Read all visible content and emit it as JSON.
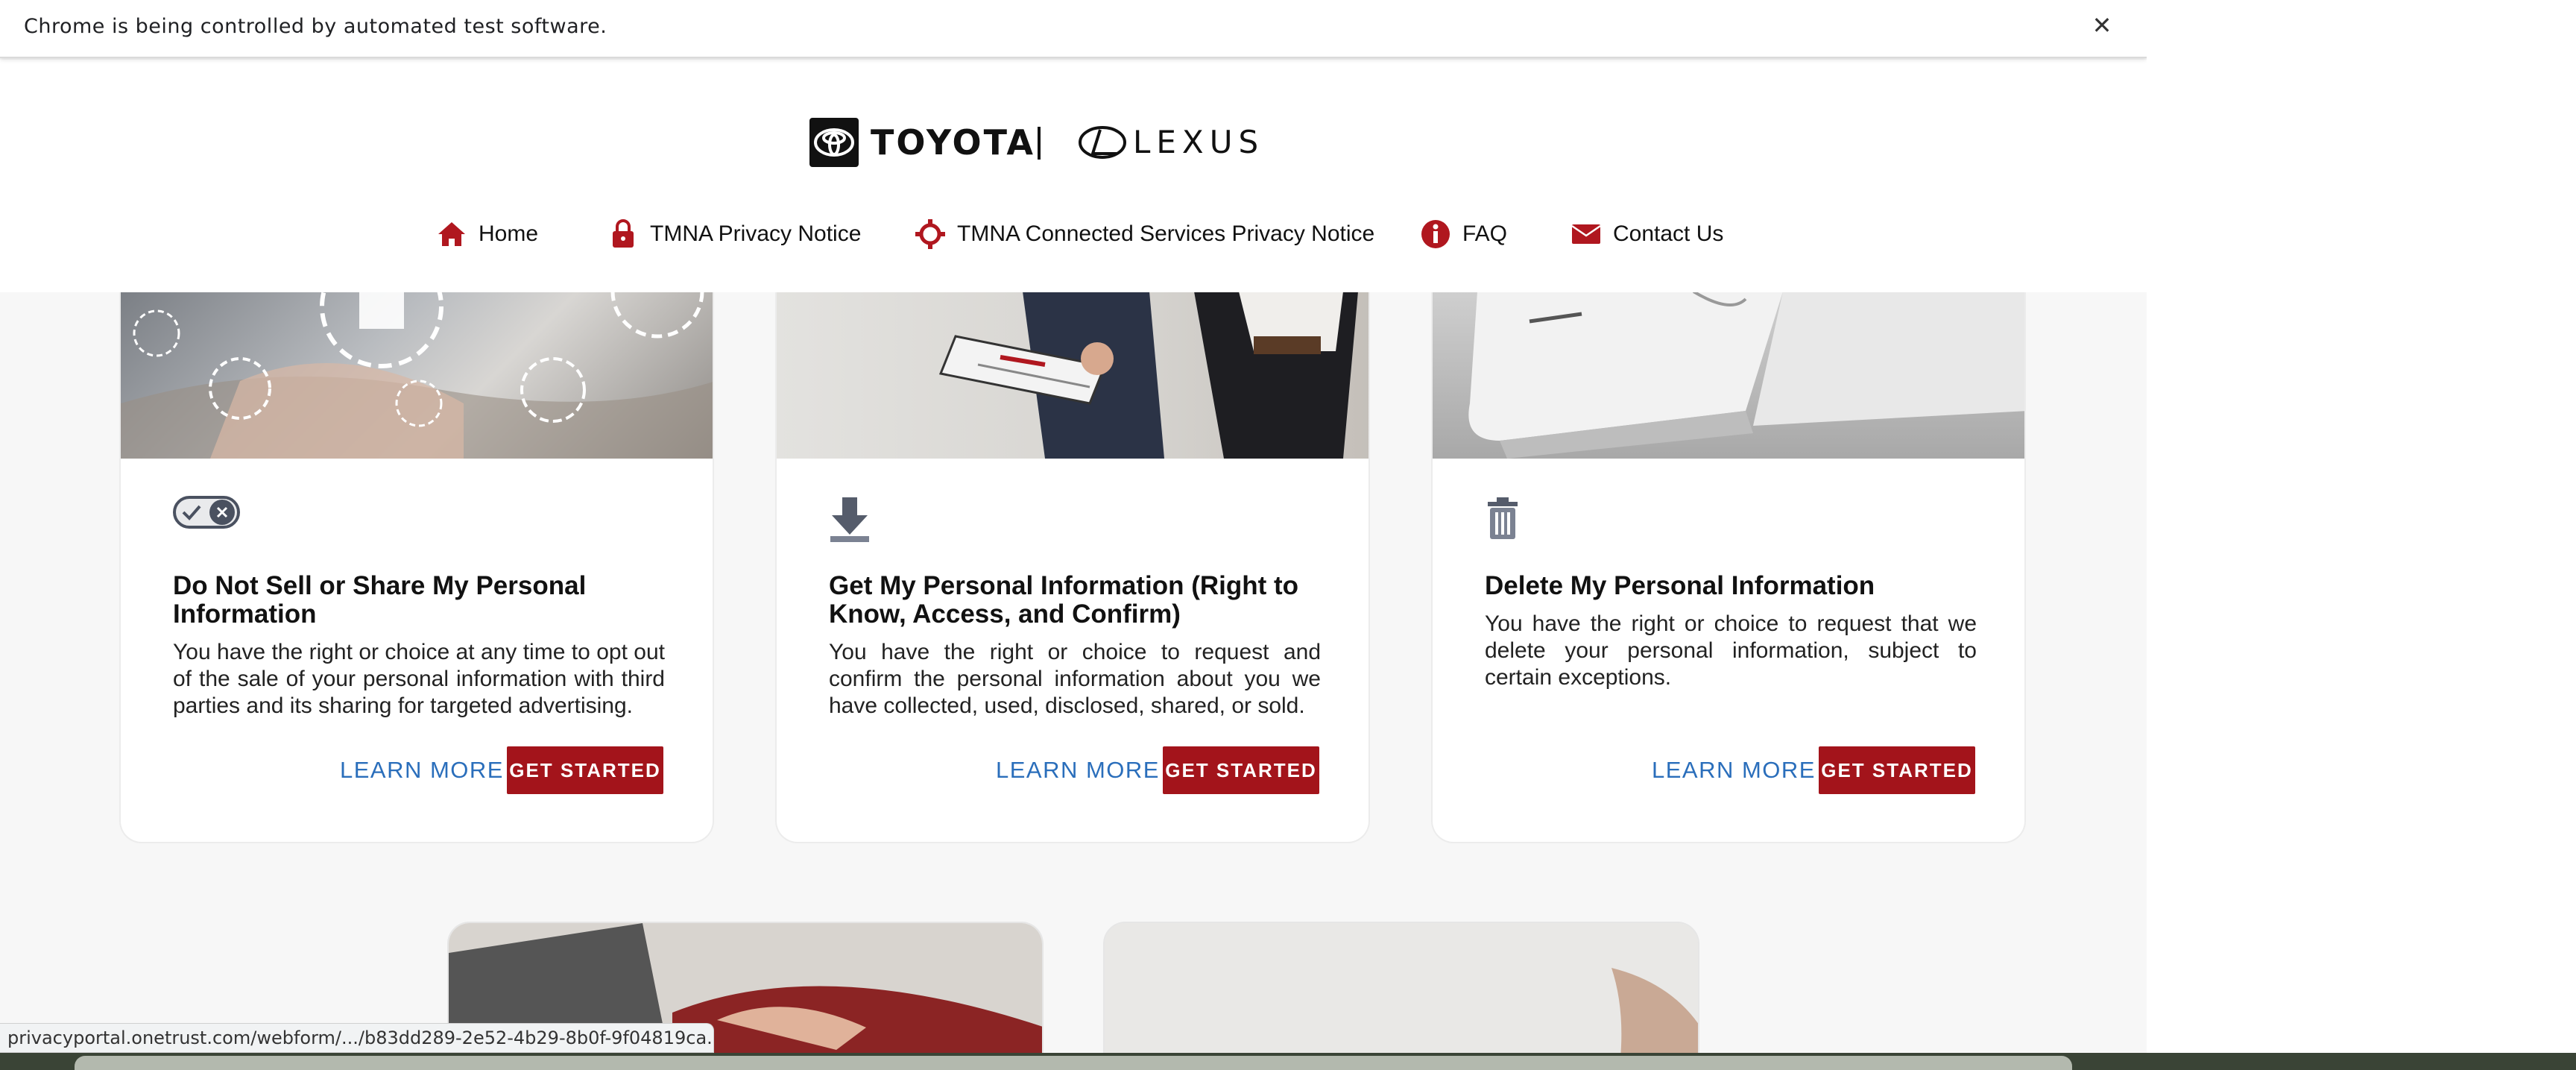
{
  "infobar": {
    "message": "Chrome is being controlled by automated test software.",
    "close_glyph": "✕"
  },
  "brand": {
    "toyota": "TOYOTA",
    "separator": "|",
    "lexus": "LEXUS"
  },
  "nav": {
    "items": [
      {
        "label": "Home",
        "icon": "home-icon"
      },
      {
        "label": "TMNA Privacy Notice",
        "icon": "lock-icon"
      },
      {
        "label": "TMNA Connected Services Privacy Notice",
        "icon": "connected-services-icon"
      },
      {
        "label": "FAQ",
        "icon": "info-icon"
      },
      {
        "label": "Contact Us",
        "icon": "envelope-icon"
      }
    ]
  },
  "cards": [
    {
      "icon": "toggle-icon",
      "title": "Do Not Sell or Share My Personal Information",
      "description": "You have the right or choice at any time to opt out of the sale of your personal information with third parties and its sharing for targeted advertising.",
      "learn_more": "LEARN MORE",
      "get_started": "GET STARTED"
    },
    {
      "icon": "download-icon",
      "title": "Get My Personal Information (Right to Know, Access, and Confirm)",
      "description": "You have the right or choice to request and confirm the personal information about you we have collected, used, disclosed, shared, or sold.",
      "learn_more": "LEARN MORE",
      "get_started": "GET STARTED"
    },
    {
      "icon": "trash-icon",
      "title": "Delete My Personal Information",
      "description": "You have the right or choice to request that we delete your personal information, subject to certain exceptions.",
      "learn_more": "LEARN MORE",
      "get_started": "GET STARTED"
    }
  ],
  "status_bar": {
    "url": "privacyportal.onetrust.com/webform/.../b83dd289-2e52-4b29-8b0f-9f04819ca..."
  },
  "colors": {
    "accent_red": "#a3141b",
    "link_blue": "#2a6ebb",
    "nav_icon_red": "#b0171f"
  }
}
